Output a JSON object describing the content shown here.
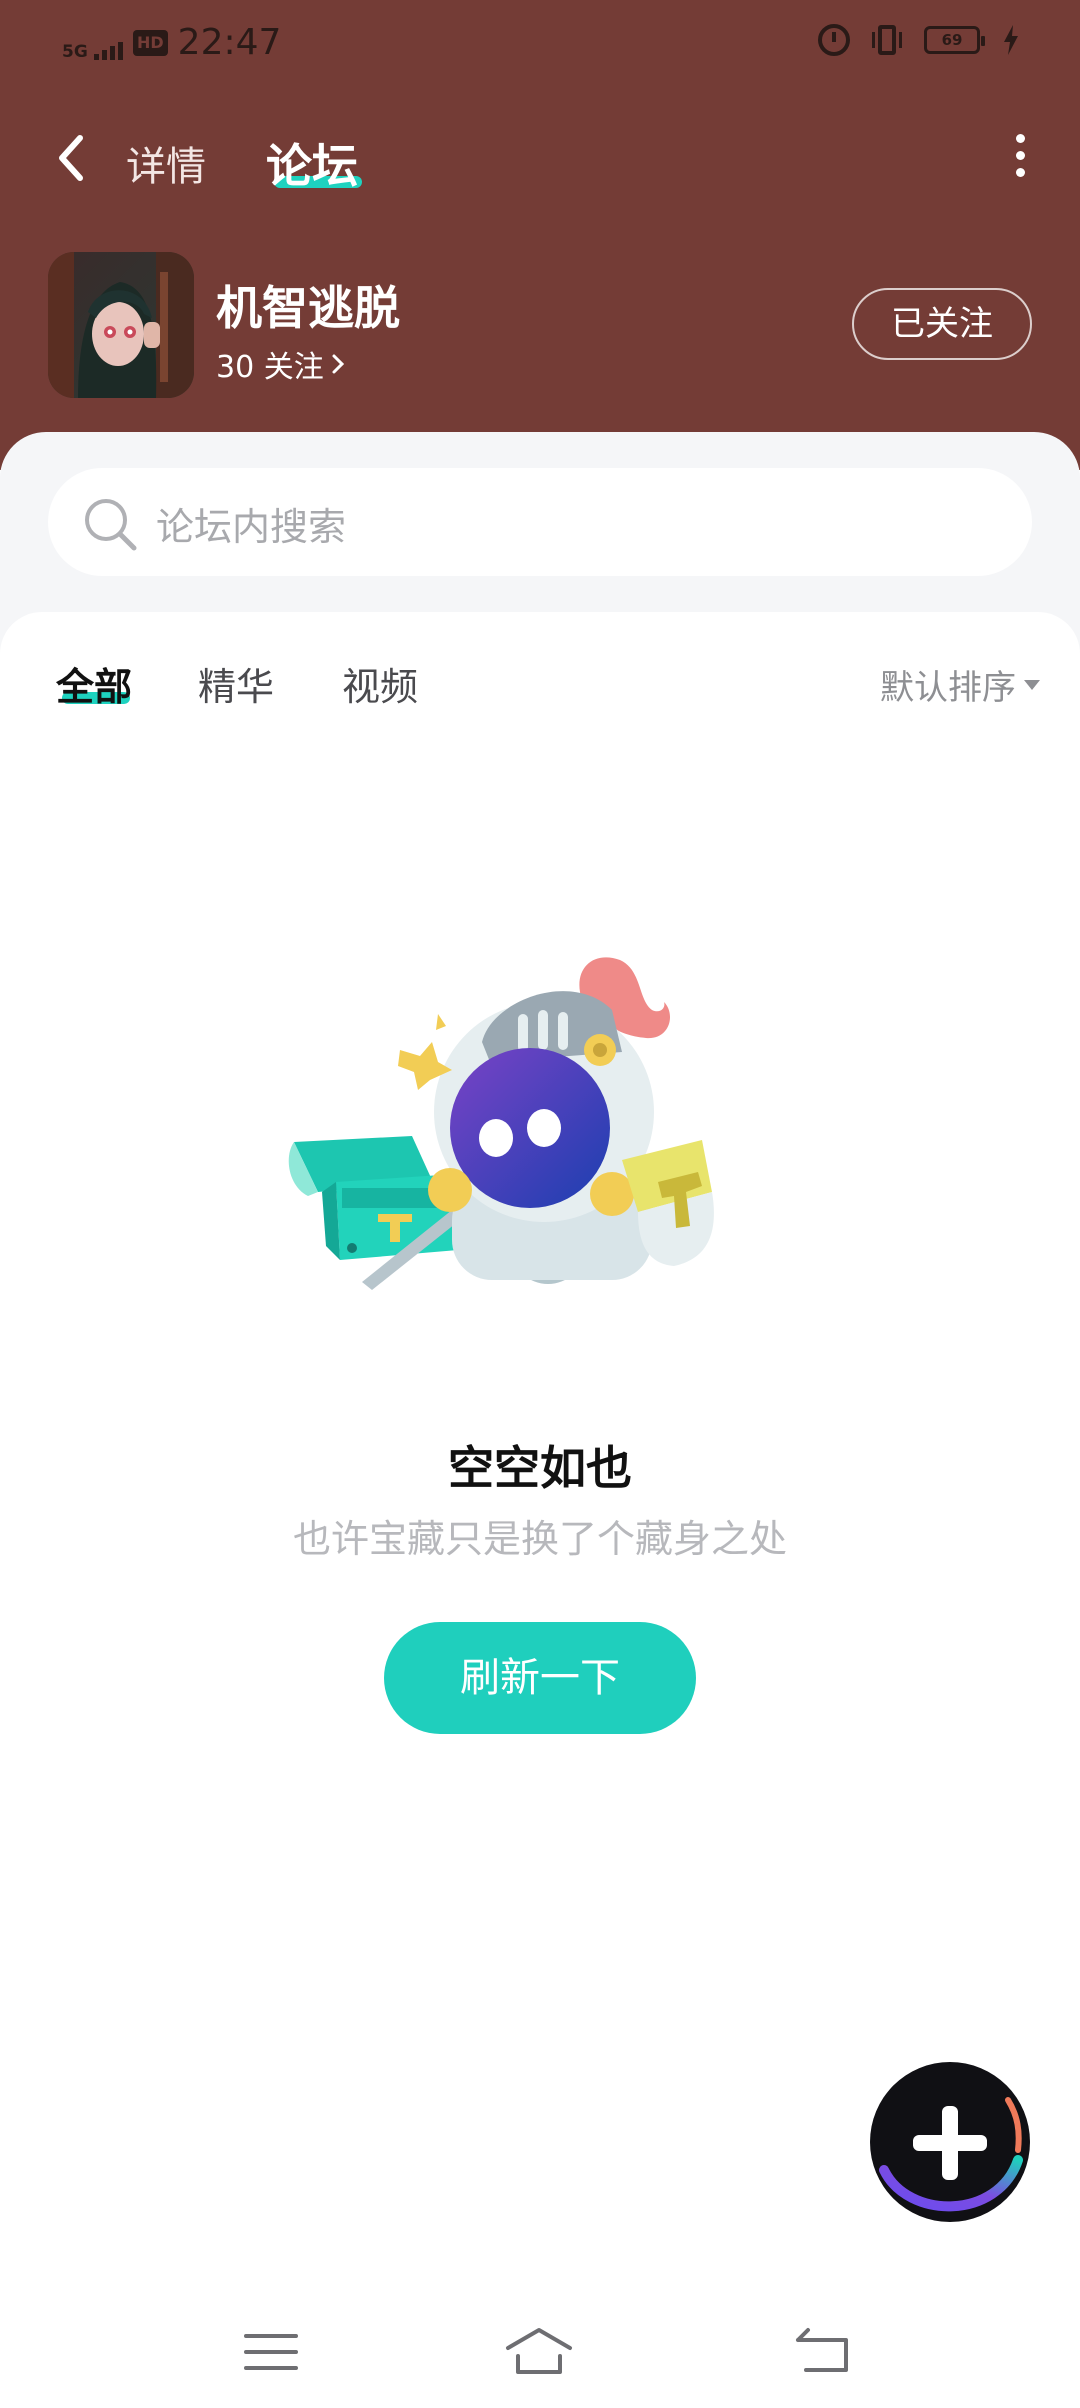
{
  "status_bar": {
    "network": "5G",
    "hd": "HD",
    "time": "22:47",
    "battery": "69"
  },
  "nav": {
    "detail_tab": "详情",
    "forum_tab": "论坛"
  },
  "game": {
    "name": "机智逃脱",
    "followers": "30 关注",
    "follow_button": "已关注"
  },
  "search": {
    "placeholder": "论坛内搜索"
  },
  "filters": {
    "tabs": [
      "全部",
      "精华",
      "视频"
    ],
    "active": "全部",
    "sort": "默认排序"
  },
  "empty_state": {
    "title": "空空如也",
    "subtitle": "也许宝藏只是换了个藏身之处",
    "button": "刷新一下"
  },
  "colors": {
    "header_bg": "#743c36",
    "accent": "#1fcfbd"
  }
}
